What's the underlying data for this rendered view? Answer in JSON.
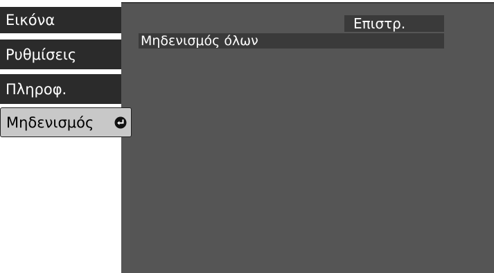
{
  "menu": {
    "items": [
      {
        "label": "Εικόνα"
      },
      {
        "label": "Ρυθμίσεις"
      },
      {
        "label": "Πληροφ."
      },
      {
        "label": "Μηδενισμός",
        "selected": true
      }
    ]
  },
  "panel": {
    "back_label": "Επιστρ.",
    "options": [
      {
        "label": "Μηδενισμός όλων"
      }
    ]
  },
  "colors": {
    "menu_bg": "#2b2b2b",
    "menu_selected_bg": "#c8c8c8",
    "panel_bg": "#555555",
    "option_bg": "#3a3a3a"
  },
  "icons": {
    "selected_item_icon": "enter-arrow-icon"
  }
}
